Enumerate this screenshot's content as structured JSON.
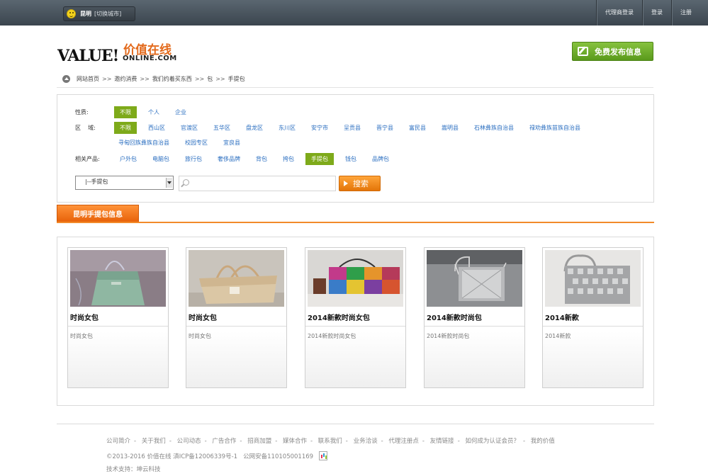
{
  "topbar": {
    "city": "昆明",
    "switch_city": "[切换城市]",
    "links": [
      "代理商登录",
      "登录",
      "注册"
    ]
  },
  "logo": {
    "main": "VALUE!",
    "cn": "价值在线",
    "sub": "ONLINE.COM"
  },
  "publish_button": "免费发布信息",
  "breadcrumb": [
    "网站首页",
    "邀约消费",
    "我们约着买东西",
    "包",
    "手提包"
  ],
  "breadcrumb_separator": ">>",
  "filters": {
    "nature_label": "性质:",
    "nature": [
      "不限",
      "个人",
      "企业"
    ],
    "region_label": "区    域:",
    "regions_row1": [
      "不限",
      "西山区",
      "官渡区",
      "五华区",
      "盘龙区",
      "东川区",
      "安宁市",
      "呈贡县",
      "晋宁县",
      "富民县",
      "嵩明县",
      "石林彝族自治县",
      "禄劝彝族苗族自治县"
    ],
    "regions_row2": [
      "寻甸回族彝族自治县",
      "校园专区",
      "宜良县"
    ],
    "products_label": "相关产品:",
    "products": [
      "户外包",
      "电脑包",
      "旅行包",
      "奢侈品牌",
      "背包",
      "挎包",
      "手提包",
      "钱包",
      "品牌包"
    ],
    "active": {
      "nature": "不限",
      "region": "不限",
      "product": "手提包"
    }
  },
  "search": {
    "select_value": "|--手提包",
    "input_value": "",
    "button": "搜索"
  },
  "section_title": "昆明手提包信息",
  "products": [
    {
      "title": "时尚女包",
      "desc": "时尚女包"
    },
    {
      "title": "时尚女包",
      "desc": "时尚女包"
    },
    {
      "title": "2014新款时尚女包",
      "desc": "2014新款时尚女包"
    },
    {
      "title": "2014新款时尚包",
      "desc": "2014新款时尚包"
    },
    {
      "title": "2014新款",
      "desc": "2014新款"
    }
  ],
  "footer": {
    "links": [
      "公司简介",
      "关于我们",
      "公司动态",
      "广告合作",
      "招商加盟",
      "媒体合作",
      "联系我们",
      "业务洽谈",
      "代理注册点",
      "友情链接",
      "如何成为认证会员？",
      "我的价值"
    ],
    "link_separator": "-",
    "copyright": "©2013-2016 价值在线 滇ICP备12006339号-1   公网安备110105001169",
    "tech": "技术支持：坤云科技"
  }
}
